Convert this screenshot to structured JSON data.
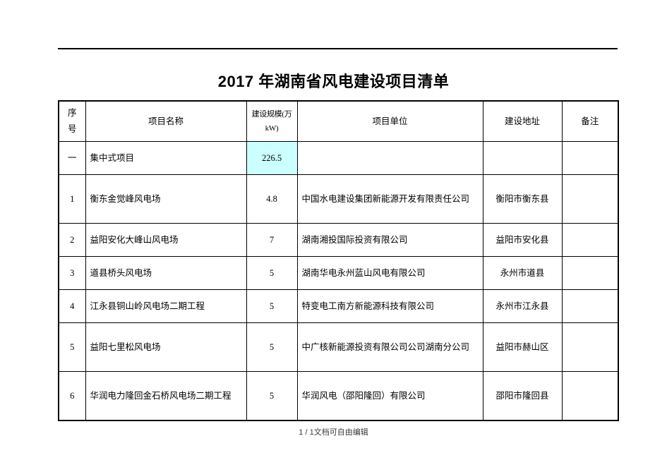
{
  "document": {
    "title": "2017 年湖南省风电建设项目清单",
    "footer": "1 / 1文档可自由编辑"
  },
  "colors": {
    "highlight_cyan": "#ccffff",
    "text": "#000000",
    "border": "#000000"
  },
  "table": {
    "headers": {
      "no": "序号",
      "name": "项目名称",
      "scale": "建设规模(万kW)",
      "unit": "项目单位",
      "address": "建设地址",
      "remark": "备注"
    },
    "rows": [
      {
        "no": "一",
        "name": "集中式项目",
        "scale": "226.5",
        "scale_highlighted": true,
        "unit": "",
        "address": "",
        "remark": ""
      },
      {
        "no": "1",
        "name": "衡东金觉峰风电场",
        "scale": "4.8",
        "scale_highlighted": false,
        "unit": "中国水电建设集团新能源开发有限责任公司",
        "address": "衡阳市衡东县",
        "remark": ""
      },
      {
        "no": "2",
        "name": "益阳安化大峰山风电场",
        "scale": "7",
        "scale_highlighted": false,
        "unit": "湖南湘投国际投资有限公司",
        "address": "益阳市安化县",
        "remark": ""
      },
      {
        "no": "3",
        "name": "道县桥头风电场",
        "scale": "5",
        "scale_highlighted": false,
        "unit": "湖南华电永州蓝山风电有限公司",
        "address": "永州市道县",
        "remark": ""
      },
      {
        "no": "4",
        "name": "江永县铜山岭风电场二期工程",
        "scale": "5",
        "scale_highlighted": false,
        "unit": "特变电工南方新能源科技有限公司",
        "address": "永州市江永县",
        "remark": ""
      },
      {
        "no": "5",
        "name": "益阳七里松风电场",
        "scale": "5",
        "scale_highlighted": false,
        "unit": "中广核新能源投资有限公司公司湖南分公司",
        "address": "益阳市赫山区",
        "remark": ""
      },
      {
        "no": "6",
        "name": "华润电力隆回金石桥风电场二期工程",
        "scale": "5",
        "scale_highlighted": false,
        "unit": "华润风电（邵阳隆回）有限公司",
        "address": "邵阳市隆回县",
        "remark": ""
      }
    ]
  }
}
